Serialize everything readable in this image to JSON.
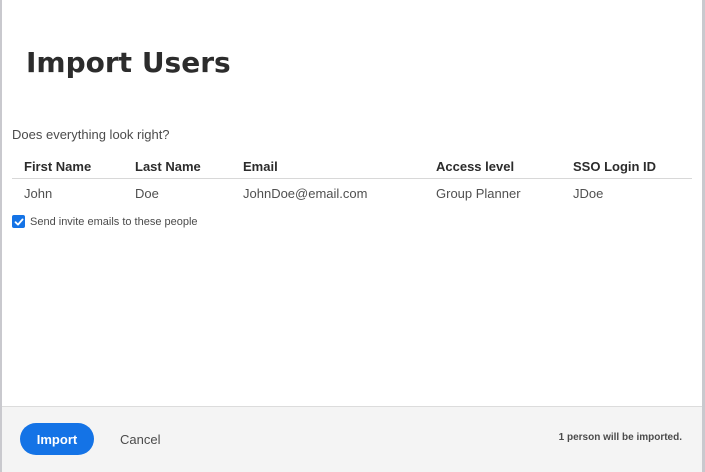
{
  "dialog": {
    "title": "Import Users",
    "prompt": "Does everything look right?"
  },
  "table": {
    "headers": [
      "First Name",
      "Last Name",
      "Email",
      "Access level",
      "SSO Login ID"
    ],
    "rows": [
      [
        "John",
        "Doe",
        "JohnDoe@email.com",
        "Group Planner",
        "JDoe"
      ]
    ]
  },
  "invite": {
    "label": "Send invite emails to these people",
    "checked": true,
    "icon": "checkmark-icon"
  },
  "footer": {
    "import_label": "Import",
    "cancel_label": "Cancel",
    "summary": "1 person will be imported."
  },
  "colors": {
    "accent": "#1473e6"
  }
}
